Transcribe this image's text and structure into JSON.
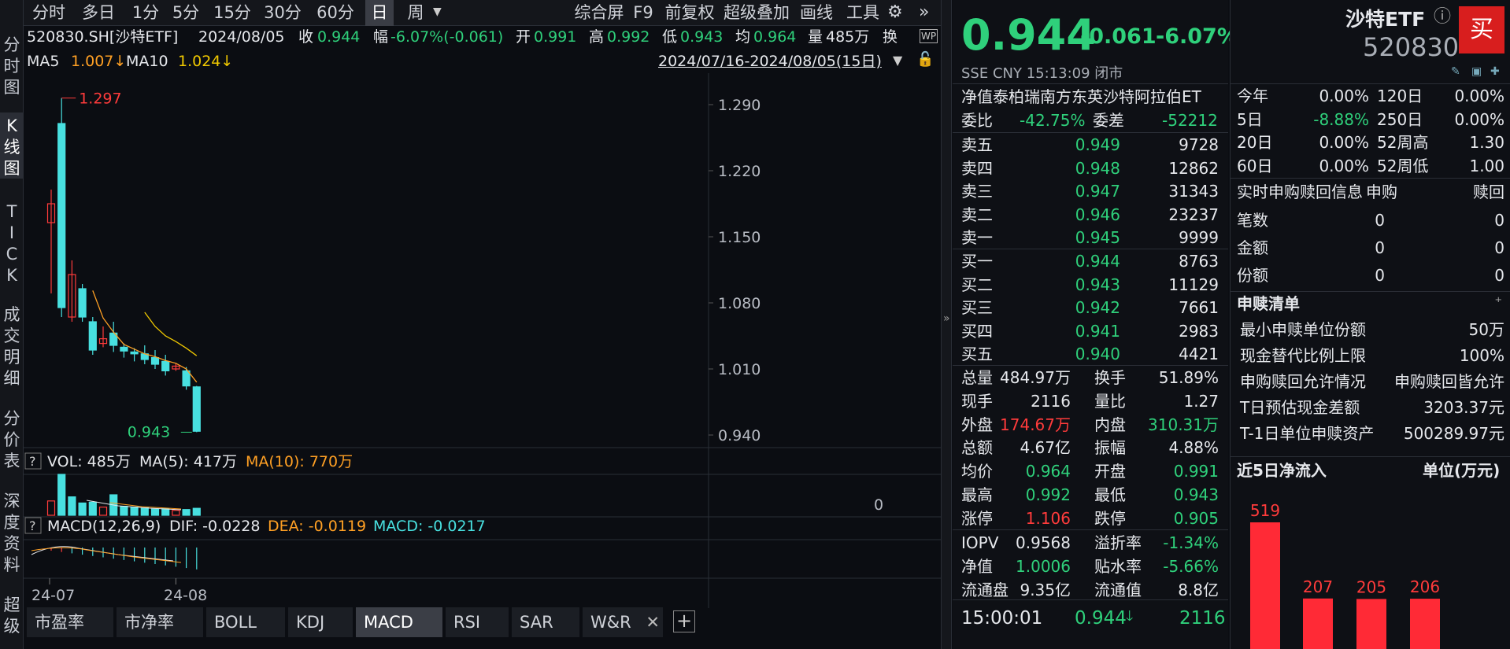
{
  "periods": [
    "分时",
    "多日",
    "1分",
    "5分",
    "15分",
    "30分",
    "60分",
    "日",
    "周"
  ],
  "active_period": "日",
  "toolbar_right": [
    "综合屏",
    "F9",
    "前复权",
    "超级叠加",
    "画线",
    "工具"
  ],
  "side_tabs": [
    "分\n时\n图",
    "K\n线\n图",
    "T\nI\nC\nK",
    "成\n交\n明\n细",
    "分\n价\n表",
    "深\n度\n资\n料",
    "超\n级"
  ],
  "info": {
    "code": "520830.SH[沙特ETF]",
    "date": "2024/08/05",
    "close_label": "收",
    "close": "0.944",
    "chg_label": "幅",
    "chg": "-6.07%(-0.061)",
    "open_label": "开",
    "open": "0.991",
    "high_label": "高",
    "high": "0.992",
    "low_label": "低",
    "low": "0.943",
    "avg_label": "均",
    "avg": "0.964",
    "vol_label": "量",
    "vol": "485万",
    "turn_label": "换"
  },
  "ma_line": {
    "ma5_label": "MA5",
    "ma5": "1.007↓",
    "ma10_label": "MA10",
    "ma10": "1.024↓"
  },
  "range": "2024/07/16-2024/08/05(15日)",
  "kline": {
    "y_ticks": [
      "1.290",
      "1.220",
      "1.150",
      "1.080",
      "1.010",
      "0.940"
    ],
    "max_label": "1.297",
    "min_label": "0.943",
    "candles": [
      {
        "o": 1.165,
        "c": 1.185,
        "h": 1.2,
        "l": 1.09
      },
      {
        "o": 1.27,
        "c": 1.075,
        "h": 1.297,
        "l": 1.065
      },
      {
        "o": 1.065,
        "c": 1.11,
        "h": 1.125,
        "l": 1.06
      },
      {
        "o": 1.095,
        "c": 1.065,
        "h": 1.1,
        "l": 1.06
      },
      {
        "o": 1.06,
        "c": 1.03,
        "h": 1.065,
        "l": 1.025
      },
      {
        "o": 1.037,
        "c": 1.042,
        "h": 1.055,
        "l": 1.033
      },
      {
        "o": 1.048,
        "c": 1.035,
        "h": 1.06,
        "l": 1.028
      },
      {
        "o": 1.033,
        "c": 1.029,
        "h": 1.037,
        "l": 1.022
      },
      {
        "o": 1.028,
        "c": 1.026,
        "h": 1.032,
        "l": 1.018
      },
      {
        "o": 1.026,
        "c": 1.02,
        "h": 1.035,
        "l": 1.015
      },
      {
        "o": 1.022,
        "c": 1.015,
        "h": 1.03,
        "l": 1.01
      },
      {
        "o": 1.018,
        "c": 1.008,
        "h": 1.025,
        "l": 1.003
      },
      {
        "o": 1.01,
        "c": 1.013,
        "h": 1.016,
        "l": 1.008
      },
      {
        "o": 1.008,
        "c": 0.992,
        "h": 1.012,
        "l": 0.988
      },
      {
        "o": 0.991,
        "c": 0.944,
        "h": 0.992,
        "l": 0.943
      }
    ],
    "ma5": [
      null,
      null,
      null,
      null,
      1.093,
      1.064,
      1.049,
      1.036,
      1.031,
      1.026,
      1.023,
      1.019,
      1.016,
      1.01,
      0.996
    ],
    "ma10": [
      null,
      null,
      null,
      null,
      null,
      null,
      null,
      null,
      null,
      1.07,
      1.055,
      1.045,
      1.039,
      1.032,
      1.024
    ]
  },
  "vol_panel": {
    "q": "?",
    "label": "VOL: 485万",
    "ma5": "MA(5): 417万",
    "ma10": "MA(10): 770万",
    "zero": "0",
    "bars": [
      {
        "v": 0.35,
        "up": true
      },
      {
        "v": 1.0,
        "up": false
      },
      {
        "v": 0.45,
        "up": false
      },
      {
        "v": 0.3,
        "up": false
      },
      {
        "v": 0.32,
        "up": false
      },
      {
        "v": 0.2,
        "up": true
      },
      {
        "v": 0.5,
        "up": false
      },
      {
        "v": 0.22,
        "up": false
      },
      {
        "v": 0.2,
        "up": false
      },
      {
        "v": 0.18,
        "up": false
      },
      {
        "v": 0.15,
        "up": false
      },
      {
        "v": 0.16,
        "up": false
      },
      {
        "v": 0.12,
        "up": true
      },
      {
        "v": 0.14,
        "up": false
      },
      {
        "v": 0.17,
        "up": false
      }
    ]
  },
  "macd_panel": {
    "q": "?",
    "label": "MACD(12,26,9)",
    "dif": "DIF: -0.0228",
    "dea": "DEA: -0.0119",
    "macd": "MACD: -0.0217"
  },
  "x_dates": [
    "24-07",
    "24-08"
  ],
  "bottom_tabs": [
    "市盈率",
    "市净率",
    "BOLL",
    "KDJ",
    "MACD",
    "RSI",
    "SAR",
    "W&R"
  ],
  "active_bottom": "MACD",
  "quote": {
    "price": "0.944",
    "change": "-0.061",
    "pct": "-6.07%",
    "name": "沙特ETF",
    "code": "520830",
    "buy": "买",
    "meta": "SSE  CNY  15:13:09  闭市",
    "fullname": "净值泰柏瑞南方东英沙特阿拉伯ET",
    "wb_label": "委比",
    "wb": "-42.75%",
    "wc_label": "委差",
    "wc": "-52212",
    "asks": [
      {
        "label": "卖五",
        "price": "0.949",
        "vol": "9728"
      },
      {
        "label": "卖四",
        "price": "0.948",
        "vol": "12862"
      },
      {
        "label": "卖三",
        "price": "0.947",
        "vol": "31343"
      },
      {
        "label": "卖二",
        "price": "0.946",
        "vol": "23237"
      },
      {
        "label": "卖一",
        "price": "0.945",
        "vol": "9999"
      }
    ],
    "bids": [
      {
        "label": "买一",
        "price": "0.944",
        "vol": "8763"
      },
      {
        "label": "买二",
        "price": "0.943",
        "vol": "11129"
      },
      {
        "label": "买三",
        "price": "0.942",
        "vol": "7661"
      },
      {
        "label": "买四",
        "price": "0.941",
        "vol": "2983"
      },
      {
        "label": "买五",
        "price": "0.940",
        "vol": "4421"
      }
    ],
    "stats": [
      {
        "l1": "总量",
        "v1": "484.97万",
        "c1": "wh",
        "l2": "换手",
        "v2": "51.89%",
        "c2": "wh"
      },
      {
        "l1": "现手",
        "v1": "2116",
        "c1": "wh",
        "l2": "量比",
        "v2": "1.27",
        "c2": "wh"
      },
      {
        "l1": "外盘",
        "v1": "174.67万",
        "c1": "up",
        "l2": "内盘",
        "v2": "310.31万",
        "c2": "dn"
      },
      {
        "l1": "总额",
        "v1": "4.67亿",
        "c1": "wh",
        "l2": "振幅",
        "v2": "4.88%",
        "c2": "wh"
      },
      {
        "l1": "均价",
        "v1": "0.964",
        "c1": "dn",
        "l2": "开盘",
        "v2": "0.991",
        "c2": "dn"
      },
      {
        "l1": "最高",
        "v1": "0.992",
        "c1": "dn",
        "l2": "最低",
        "v2": "0.943",
        "c2": "dn"
      },
      {
        "l1": "涨停",
        "v1": "1.106",
        "c1": "up",
        "l2": "跌停",
        "v2": "0.905",
        "c2": "dn"
      }
    ],
    "stats2": [
      {
        "l1": "IOPV",
        "v1": "0.9568",
        "c1": "wh",
        "l2": "溢折率",
        "v2": "-1.34%",
        "c2": "dn"
      },
      {
        "l1": "净值",
        "v1": "1.0006",
        "c1": "dn",
        "l2": "贴水率",
        "v2": "-5.66%",
        "c2": "dn"
      },
      {
        "l1": "流通盘",
        "v1": "9.35亿",
        "c1": "wh",
        "l2": "流通值",
        "v2": "8.8亿",
        "c2": "wh"
      }
    ],
    "tick_time": "15:00:01",
    "tick_price": "0.944",
    "tick_vol": "2116"
  },
  "perf": [
    {
      "l1": "今年",
      "v1": "0.00%",
      "c1": "wh",
      "l2": "120日",
      "v2": "0.00%",
      "c2": "wh"
    },
    {
      "l1": "5日",
      "v1": "-8.88%",
      "c1": "dn",
      "l2": "250日",
      "v2": "0.00%",
      "c2": "wh"
    },
    {
      "l1": "20日",
      "v1": "0.00%",
      "c1": "wh",
      "l2": "52周高",
      "v2": "1.30",
      "c2": "wh"
    },
    {
      "l1": "60日",
      "v1": "0.00%",
      "c1": "wh",
      "l2": "52周低",
      "v2": "1.00",
      "c2": "wh"
    }
  ],
  "redeem": {
    "title": "实时申购赎回信息",
    "c1": "申购",
    "c2": "赎回",
    "rows": [
      {
        "l": "笔数",
        "a": "0",
        "b": "0"
      },
      {
        "l": "金额",
        "a": "0",
        "b": "0"
      },
      {
        "l": "份额",
        "a": "0",
        "b": "0"
      }
    ]
  },
  "list": {
    "title": "申赎清单",
    "rows": [
      {
        "l": "最小申赎单位份额",
        "v": "50万"
      },
      {
        "l": "现金替代比例上限",
        "v": "100%"
      },
      {
        "l": "申购赎回允许情况",
        "v": "申购赎回皆允许"
      },
      {
        "l": "T日预估现金差额",
        "v": "3203.37元"
      },
      {
        "l": "T-1日单位申赎资产",
        "v": "500289.97元"
      }
    ]
  },
  "flow": {
    "title": "近5日净流入",
    "unit": "单位(万元)",
    "values": [
      519,
      207,
      205,
      206
    ],
    "labels": [
      "519",
      "207",
      "205",
      "206"
    ]
  }
}
